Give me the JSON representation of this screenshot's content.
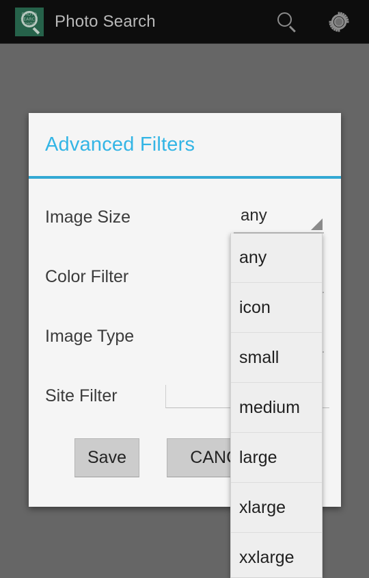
{
  "action_bar": {
    "app_title": "Photo Search",
    "app_icon_text": "PHOTO SEARCH SHOP",
    "search_icon": "search-icon",
    "settings_icon": "gear-icon",
    "background_color": "#0d0d0d",
    "title_color": "#b9b9b9"
  },
  "dialog": {
    "title": "Advanced Filters",
    "title_color": "#33b5e5",
    "divider_color": "#33a9d4",
    "background_color": "#f5f5f5",
    "rows": [
      {
        "label": "Image Size",
        "control": "spinner",
        "value": "any"
      },
      {
        "label": "Color Filter",
        "control": "spinner",
        "value": ""
      },
      {
        "label": "Image Type",
        "control": "spinner",
        "value": ""
      },
      {
        "label": "Site Filter",
        "control": "edittext",
        "value": ""
      }
    ],
    "buttons": {
      "save_label": "Save",
      "cancel_label": "CANCEL"
    }
  },
  "spinner_dropdown": {
    "open_for": "Image Size",
    "selected": "any",
    "options": [
      "any",
      "icon",
      "small",
      "medium",
      "large",
      "xlarge",
      "xxlarge"
    ]
  },
  "scrim": {
    "color": "#666666"
  }
}
